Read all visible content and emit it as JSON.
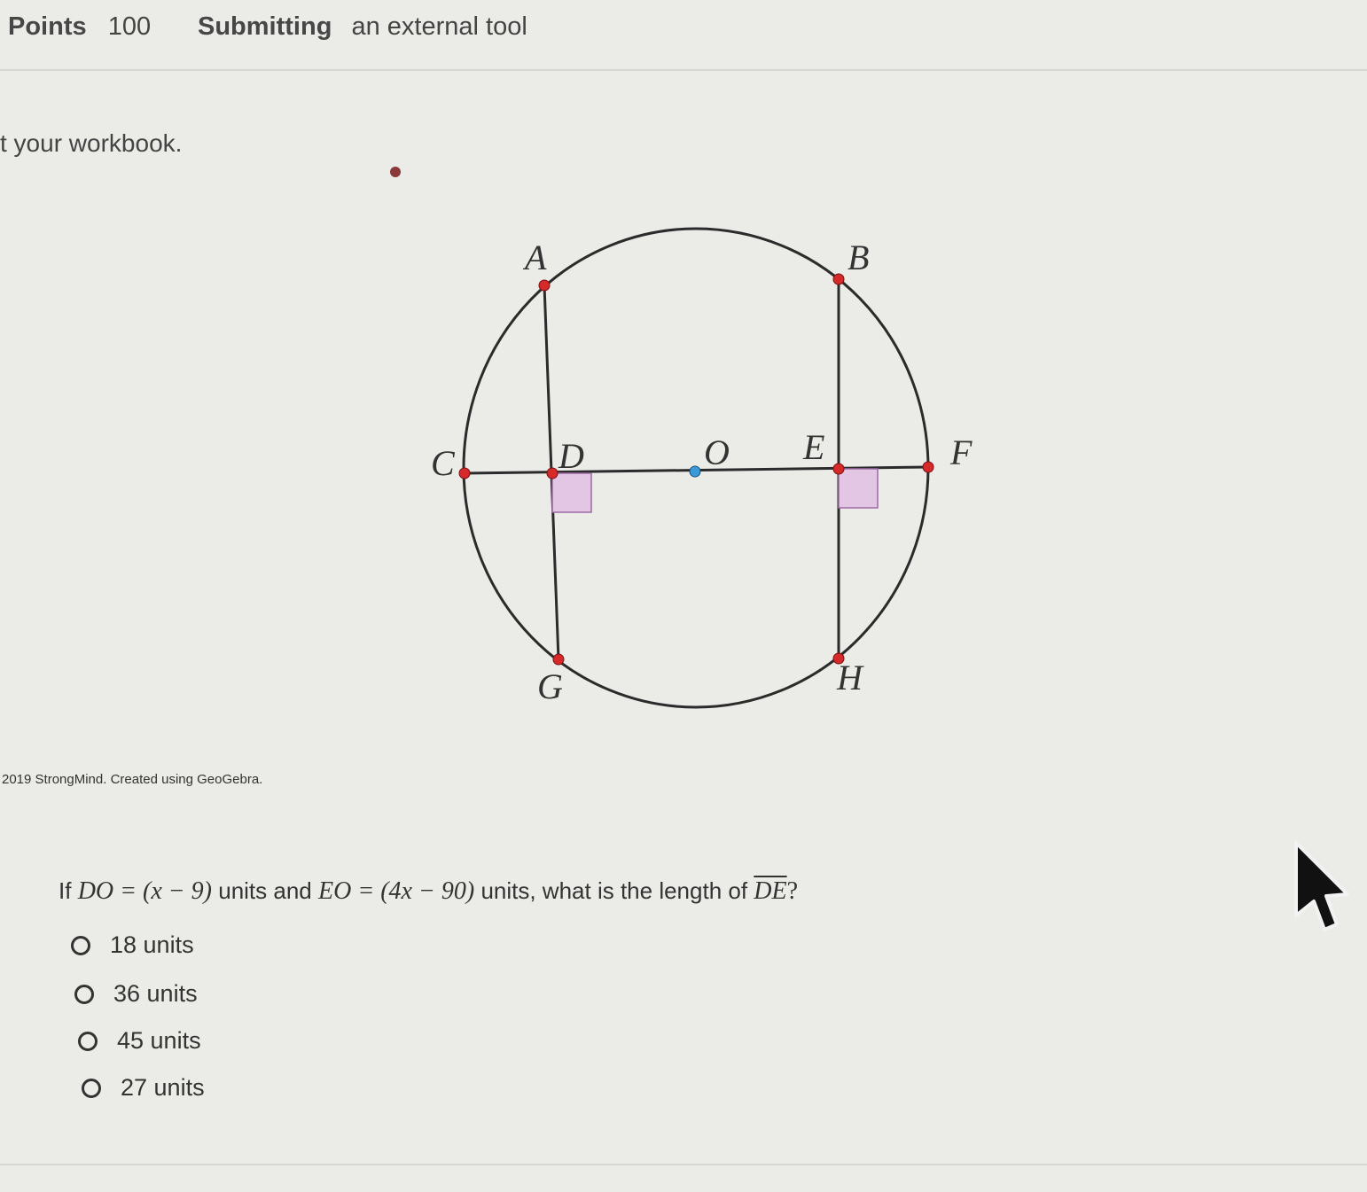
{
  "header": {
    "points_label": "Points",
    "points_value": "100",
    "submitting_label": "Submitting",
    "submitting_value": "an external tool"
  },
  "instructions": "t your workbook.",
  "figure": {
    "labels": {
      "A": "A",
      "B": "B",
      "C": "C",
      "D": "D",
      "O": "O",
      "E": "E",
      "F": "F",
      "G": "G",
      "H": "H"
    },
    "colors": {
      "circle": "#2b2b2b",
      "point": "#d62a2a",
      "center": "#3a9ad9",
      "right_angle": "#e2c6e4"
    }
  },
  "credit": "2019 StrongMind. Created using GeoGebra.",
  "question": {
    "prefix": "If",
    "expr1": "DO = (x − 9)",
    "mid1": "units and",
    "expr2": "EO = (4x − 90)",
    "mid2": "units, what is the length of",
    "segment": "DE",
    "suffix": "?"
  },
  "choices": [
    {
      "label": "18 units"
    },
    {
      "label": "36 units"
    },
    {
      "label": "45 units"
    },
    {
      "label": "27 units"
    }
  ],
  "cursor_icon": "arrow-cursor-icon"
}
